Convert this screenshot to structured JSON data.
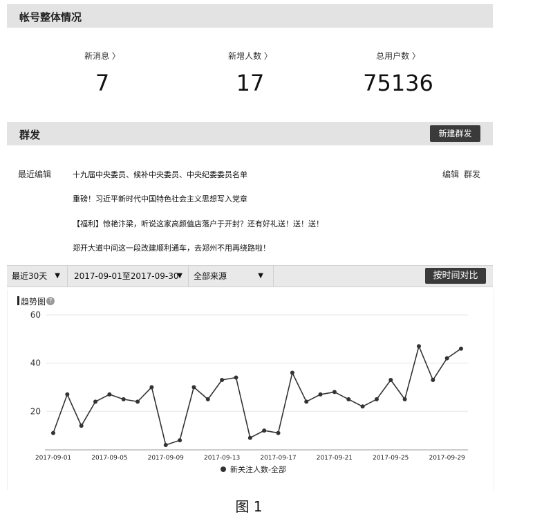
{
  "overview": {
    "title": "帐号整体情况",
    "stats": [
      {
        "label": "新消息 〉",
        "value": "7"
      },
      {
        "label": "新增人数 〉",
        "value": "17"
      },
      {
        "label": "总用户数 〉",
        "value": "75136"
      }
    ]
  },
  "mass": {
    "title": "群发",
    "new_button": "新建群发",
    "recent_label": "最近编辑",
    "items": [
      "十九届中央委员、候补中央委员、中央纪委委员名单",
      "重磅！习近平新时代中国特色社会主义思想写入党章",
      "【福利】惊艳汴梁，听说这家高颜值店落户于开封？还有好礼送！送！送！",
      "郑开大道中间这一段改建顺利通车，去郑州不用再绕路啦！"
    ],
    "edit_link": "编辑",
    "send_link": "群发"
  },
  "filters": {
    "period": "最近30天",
    "range": "2017-09-01至2017-09-30",
    "source": "全部来源",
    "compare_button": "按时间对比",
    "dropdown_arrow": "▼"
  },
  "trend": {
    "title": "趋势图",
    "help_icon": "?"
  },
  "chart_data": {
    "type": "line",
    "x": [
      "2017-09-01",
      "2017-09-02",
      "2017-09-03",
      "2017-09-04",
      "2017-09-05",
      "2017-09-06",
      "2017-09-07",
      "2017-09-08",
      "2017-09-09",
      "2017-09-10",
      "2017-09-11",
      "2017-09-12",
      "2017-09-13",
      "2017-09-14",
      "2017-09-15",
      "2017-09-16",
      "2017-09-17",
      "2017-09-18",
      "2017-09-19",
      "2017-09-20",
      "2017-09-21",
      "2017-09-22",
      "2017-09-23",
      "2017-09-24",
      "2017-09-25",
      "2017-09-26",
      "2017-09-27",
      "2017-09-28",
      "2017-09-29",
      "2017-09-30"
    ],
    "xticks": [
      "2017-09-01",
      "2017-09-05",
      "2017-09-09",
      "2017-09-13",
      "2017-09-17",
      "2017-09-21",
      "2017-09-25",
      "2017-09-29"
    ],
    "series": [
      {
        "name": "新关注人数-全部",
        "values": [
          11,
          27,
          14,
          24,
          27,
          25,
          24,
          30,
          6,
          8,
          30,
          25,
          33,
          34,
          9,
          12,
          11,
          36,
          24,
          27,
          28,
          25,
          22,
          25,
          33,
          25,
          47,
          33,
          42,
          46
        ]
      }
    ],
    "yticks": [
      20,
      40,
      60
    ],
    "ylim": [
      4,
      62
    ],
    "grid": true,
    "legend": "bottom",
    "color": "#333333"
  },
  "caption": "图 1"
}
